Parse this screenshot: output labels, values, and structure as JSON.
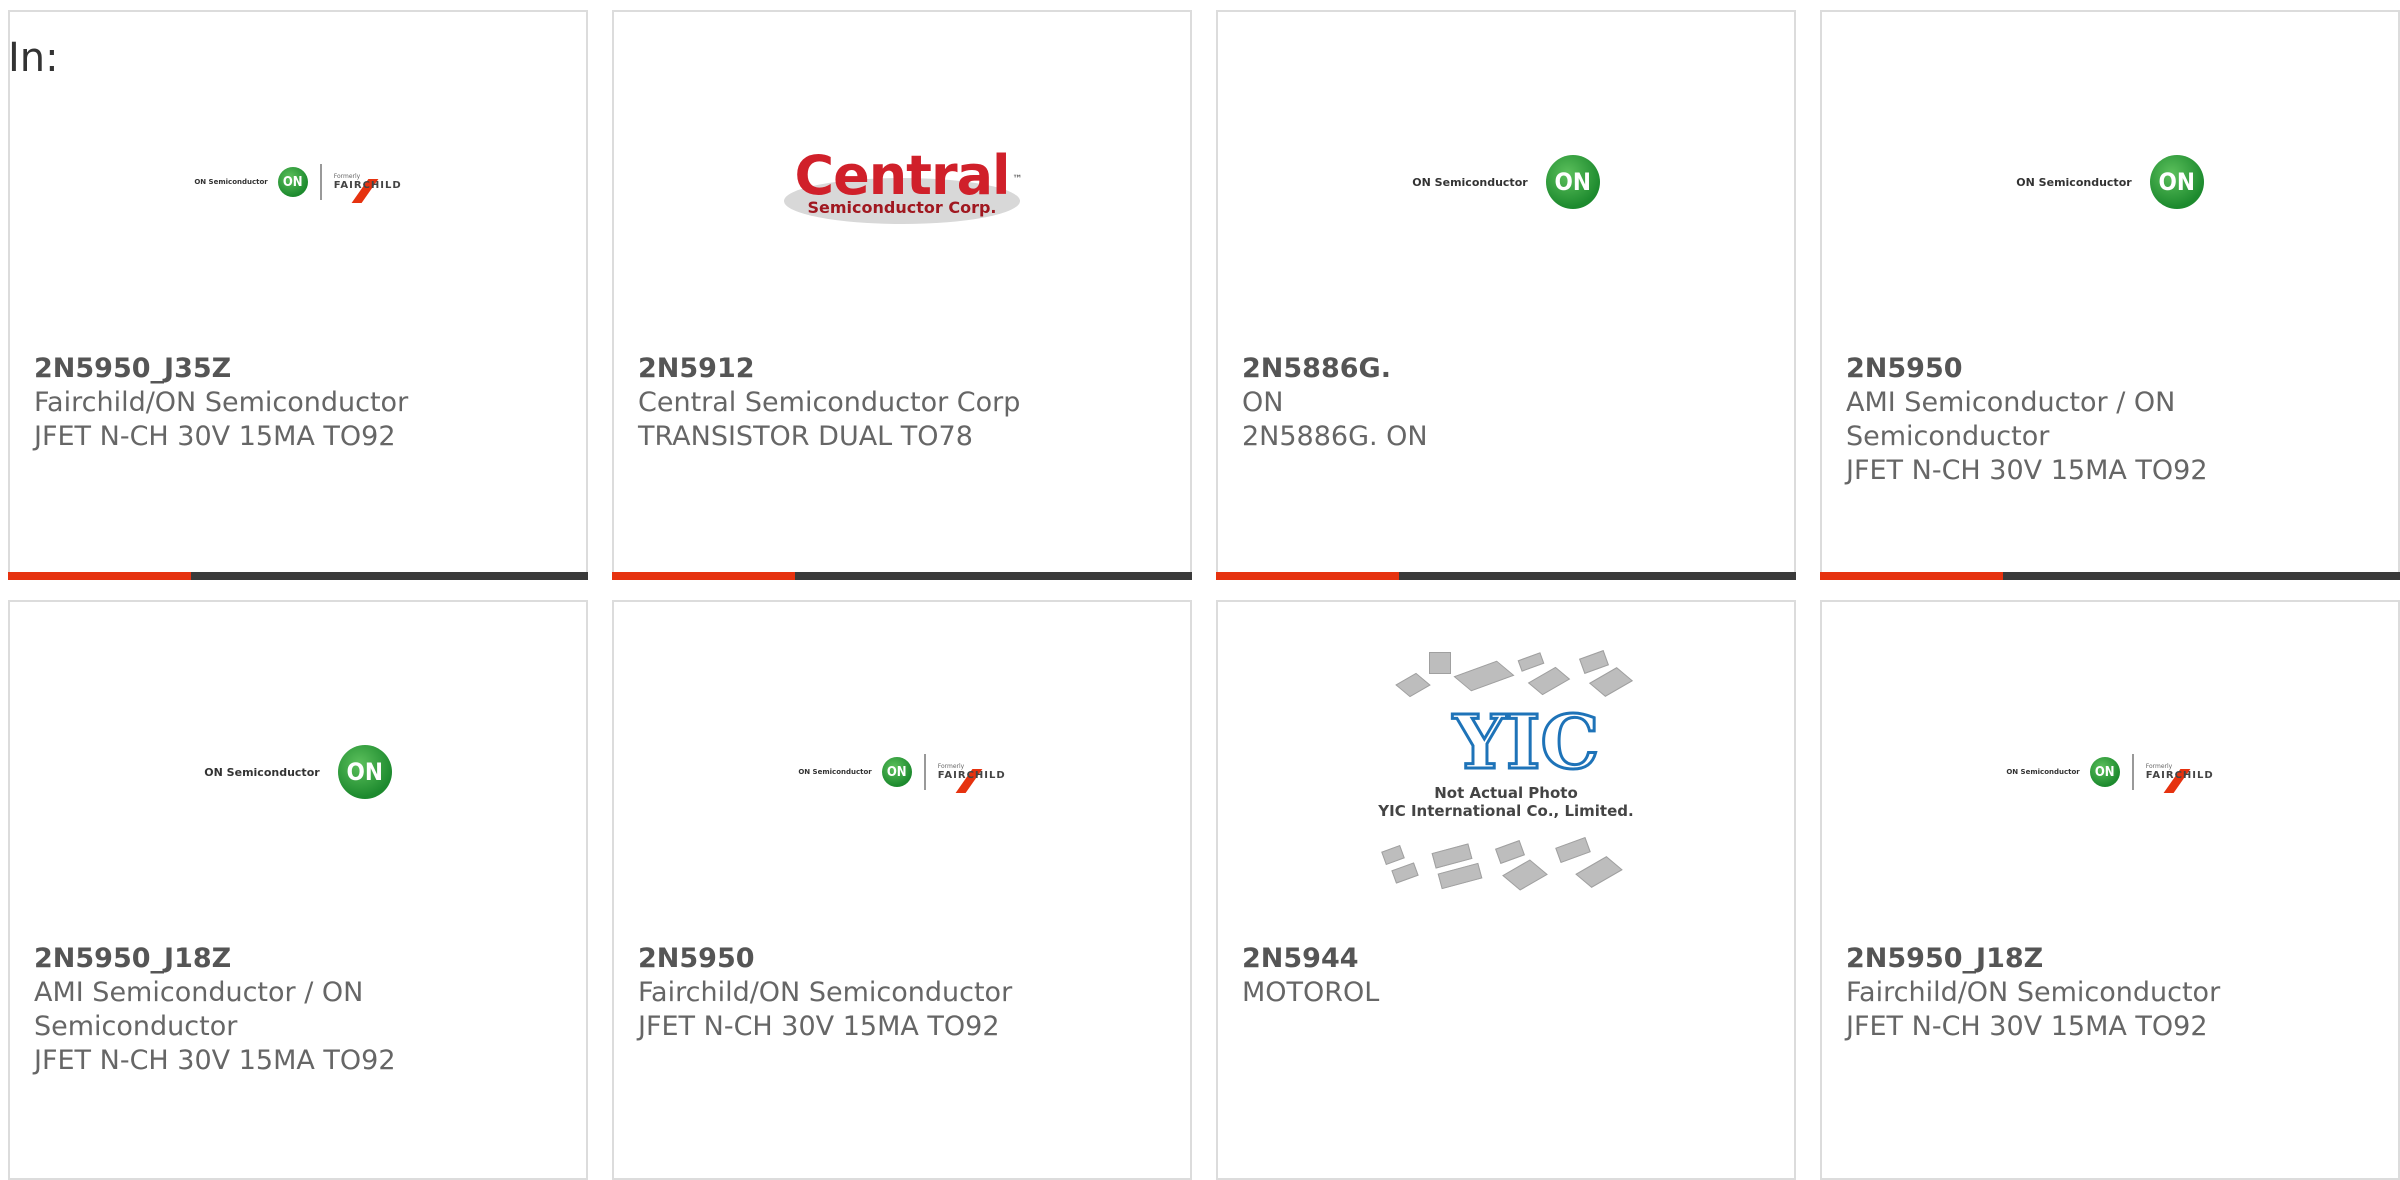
{
  "header": {
    "in_label": "In:"
  },
  "colors": {
    "accent": "#e6320f",
    "bar_dark": "#3a3a3a",
    "border": "#dcdcdc",
    "on_green": "#1d8a2e",
    "central_red": "#d0202a"
  },
  "products": [
    {
      "part": "2N5950_J35Z",
      "maker": "Fairchild/ON Semiconductor",
      "desc": "JFET N-CH 30V 15MA TO92",
      "logo": "on-fairchild-logo",
      "logo_text": {
        "on": "ON Semiconductor",
        "badge": "ON",
        "formerly": "Formerly",
        "fairchild": "FAIRCHILD"
      }
    },
    {
      "part": "2N5912",
      "maker": "Central Semiconductor Corp",
      "desc": "TRANSISTOR DUAL TO78",
      "logo": "central-logo",
      "logo_text": {
        "name": "Central",
        "tm": "™",
        "sub": "Semiconductor Corp."
      }
    },
    {
      "part": "2N5886G.",
      "maker": "ON",
      "desc": "2N5886G. ON",
      "logo": "on-semiconductor-logo",
      "logo_text": {
        "on": "ON Semiconductor",
        "badge": "ON"
      }
    },
    {
      "part": "2N5950",
      "maker": "AMI Semiconductor / ON Semiconductor",
      "desc": "JFET N-CH 30V 15MA TO92",
      "logo": "on-semiconductor-logo",
      "logo_text": {
        "on": "ON Semiconductor",
        "badge": "ON"
      }
    },
    {
      "part": "2N5950_J18Z",
      "maker": "AMI Semiconductor / ON Semiconductor",
      "desc": "JFET N-CH 30V 15MA TO92",
      "logo": "on-semiconductor-logo",
      "logo_text": {
        "on": "ON Semiconductor",
        "badge": "ON"
      }
    },
    {
      "part": "2N5950",
      "maker": "Fairchild/ON Semiconductor",
      "desc": "JFET N-CH 30V 15MA TO92",
      "logo": "on-fairchild-logo",
      "logo_text": {
        "on": "ON Semiconductor",
        "badge": "ON",
        "formerly": "Formerly",
        "fairchild": "FAIRCHILD"
      }
    },
    {
      "part": "2N5944",
      "maker": "MOTOROL",
      "desc": "",
      "logo": "yic-placeholder-image",
      "logo_text": {
        "mark": "YIC",
        "line1": "Not Actual Photo",
        "line2": "YIC International Co., Limited."
      }
    },
    {
      "part": "2N5950_J18Z",
      "maker": "Fairchild/ON Semiconductor",
      "desc": "JFET N-CH 30V 15MA TO92",
      "logo": "on-fairchild-logo",
      "logo_text": {
        "on": "ON Semiconductor",
        "badge": "ON",
        "formerly": "Formerly",
        "fairchild": "FAIRCHILD"
      }
    }
  ]
}
